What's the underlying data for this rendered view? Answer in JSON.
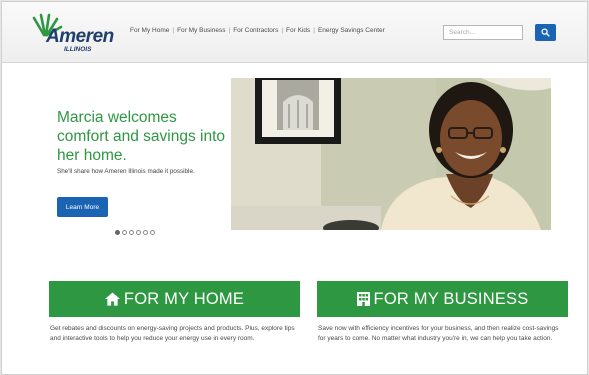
{
  "brand": {
    "name": "Ameren",
    "sub": "ILLINOIS"
  },
  "nav": {
    "items": [
      {
        "label": "For My Home"
      },
      {
        "label": "For My Business"
      },
      {
        "label": "For Contractors"
      },
      {
        "label": "For Kids"
      },
      {
        "label": "Energy Savings Center"
      }
    ],
    "separator": "|"
  },
  "search": {
    "placeholder": "Search...",
    "button_icon": "search-icon"
  },
  "hero": {
    "headline": "Marcia welcomes comfort and savings into her home.",
    "subtext": "She'll share how Ameren Illinois made it possible.",
    "button_label": "Learn More",
    "carousel": {
      "count": 6,
      "active_index": 0
    }
  },
  "cta": {
    "home": {
      "label": "FOR MY HOME",
      "icon": "home-icon",
      "description": "Get rebates and discounts on energy-saving projects and products. Plus, explore tips and interactive tools to help you reduce your energy use in every room."
    },
    "business": {
      "label": "FOR MY BUSINESS",
      "icon": "building-icon",
      "description": "Save now with efficiency incentives for your business, and then realize cost-savings for years to come. No matter what industry you're in, we can help you take action."
    }
  },
  "colors": {
    "brand_green": "#2e9742",
    "brand_blue": "#1b63b3",
    "logo_navy": "#1f3f6b"
  }
}
